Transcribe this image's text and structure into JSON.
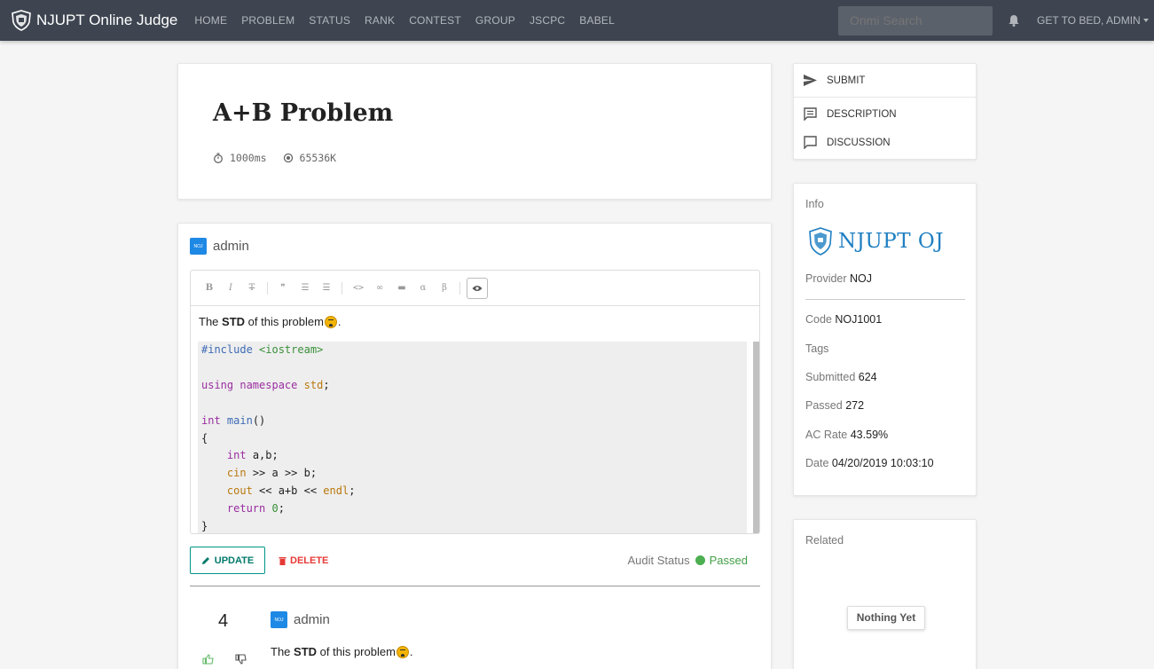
{
  "navbar": {
    "brand": "NJUPT Online Judge",
    "links": [
      "HOME",
      "PROBLEM",
      "STATUS",
      "RANK",
      "CONTEST",
      "GROUP",
      "JSCPC",
      "BABEL"
    ],
    "search_placeholder": "Onmi Search",
    "user": "GET TO BED, ADMIN",
    "bg_color": "#3e4551"
  },
  "problem": {
    "title": "A+B Problem",
    "time_limit": "1000ms",
    "memory_limit": "65536K"
  },
  "side_menu": {
    "submit": "SUBMIT",
    "description": "DESCRIPTION",
    "discussion": "DISCUSSION"
  },
  "info": {
    "heading": "Info",
    "logo_text": "NJUPT OJ",
    "provider_label": "Provider",
    "provider": "NOJ",
    "code_label": "Code",
    "code": "NOJ1001",
    "tags_label": "Tags",
    "submitted_label": "Submitted",
    "submitted": "624",
    "passed_label": "Passed",
    "passed": "272",
    "ac_rate_label": "AC Rate",
    "ac_rate": "43.59%",
    "date_label": "Date",
    "date": "04/20/2019 10:03:10"
  },
  "related": {
    "heading": "Related",
    "empty": "Nothing Yet"
  },
  "discussion": {
    "author": "admin",
    "avatar_text": "NOJ",
    "text_before": "The",
    "text_bold": "STD",
    "text_after": "of this problem",
    "text_end": ".",
    "code_lines": [
      "#include <iostream>",
      "",
      "using namespace std;",
      "",
      "int main()",
      "{",
      "    int a,b;",
      "    cin >> a >> b;",
      "    cout << a+b << endl;",
      "    return 0;",
      "}"
    ],
    "update_label": "UPDATE",
    "delete_label": "DELETE",
    "audit_label": "Audit Status",
    "audit_status": "Passed",
    "reply": {
      "votes": "4",
      "author": "admin",
      "text_before": "The",
      "text_bold": "STD",
      "text_after": "of this problem",
      "text_end": "."
    }
  }
}
